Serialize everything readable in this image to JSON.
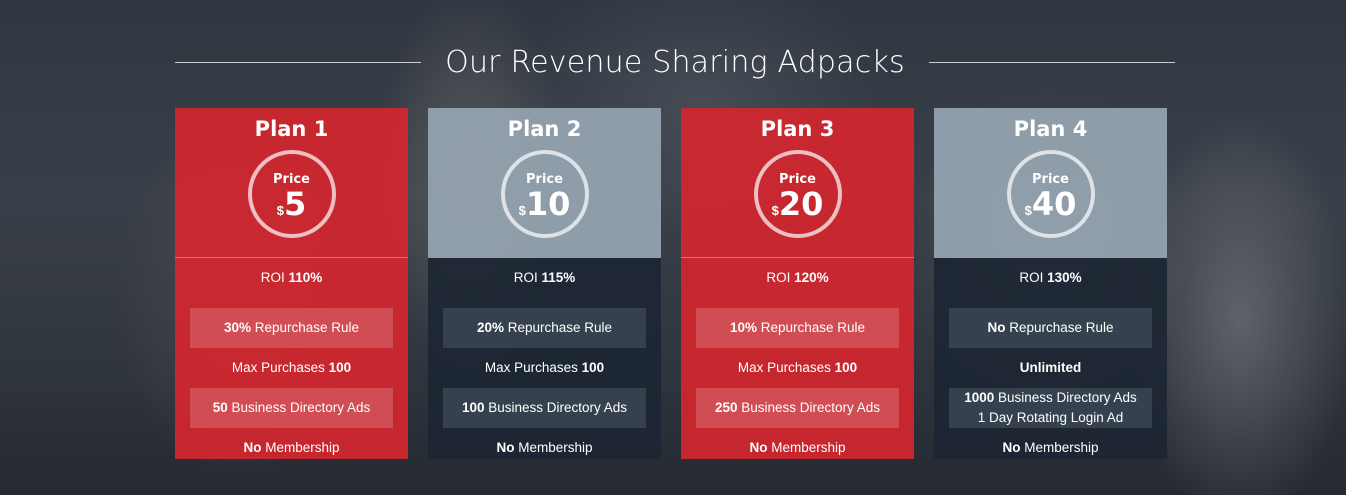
{
  "section_title": "Our Revenue Sharing Adpacks",
  "colors": {
    "red_card": "#d4262e",
    "gray_head": "#96a4b0",
    "dark_body": "#1c2632"
  },
  "plans": [
    {
      "name": "Plan 1",
      "price_label": "Price",
      "currency": "$",
      "price": "5",
      "roi_label": "ROI",
      "roi": "110%",
      "repurchase_value": "30%",
      "repurchase_text": "Repurchase Rule",
      "max_label": "Max Purchases",
      "max_value": "100",
      "ads_value": "50",
      "ads_text": "Business Directory Ads",
      "ads_extra": "",
      "membership_value": "No",
      "membership_text": "Membership"
    },
    {
      "name": "Plan 2",
      "price_label": "Price",
      "currency": "$",
      "price": "10",
      "roi_label": "ROI",
      "roi": "115%",
      "repurchase_value": "20%",
      "repurchase_text": "Repurchase Rule",
      "max_label": "Max Purchases",
      "max_value": "100",
      "ads_value": "100",
      "ads_text": "Business Directory Ads",
      "ads_extra": "",
      "membership_value": "No",
      "membership_text": "Membership"
    },
    {
      "name": "Plan 3",
      "price_label": "Price",
      "currency": "$",
      "price": "20",
      "roi_label": "ROI",
      "roi": "120%",
      "repurchase_value": "10%",
      "repurchase_text": "Repurchase Rule",
      "max_label": "Max Purchases",
      "max_value": "100",
      "ads_value": "250",
      "ads_text": "Business Directory Ads",
      "ads_extra": "",
      "membership_value": "No",
      "membership_text": "Membership"
    },
    {
      "name": "Plan 4",
      "price_label": "Price",
      "currency": "$",
      "price": "40",
      "roi_label": "ROI",
      "roi": "130%",
      "repurchase_value": "No",
      "repurchase_text": "Repurchase Rule",
      "max_label": "",
      "max_value": "Unlimited",
      "ads_value": "1000",
      "ads_text": "Business Directory Ads",
      "ads_extra": "1 Day Rotating Login Ad",
      "membership_value": "No",
      "membership_text": "Membership"
    }
  ]
}
